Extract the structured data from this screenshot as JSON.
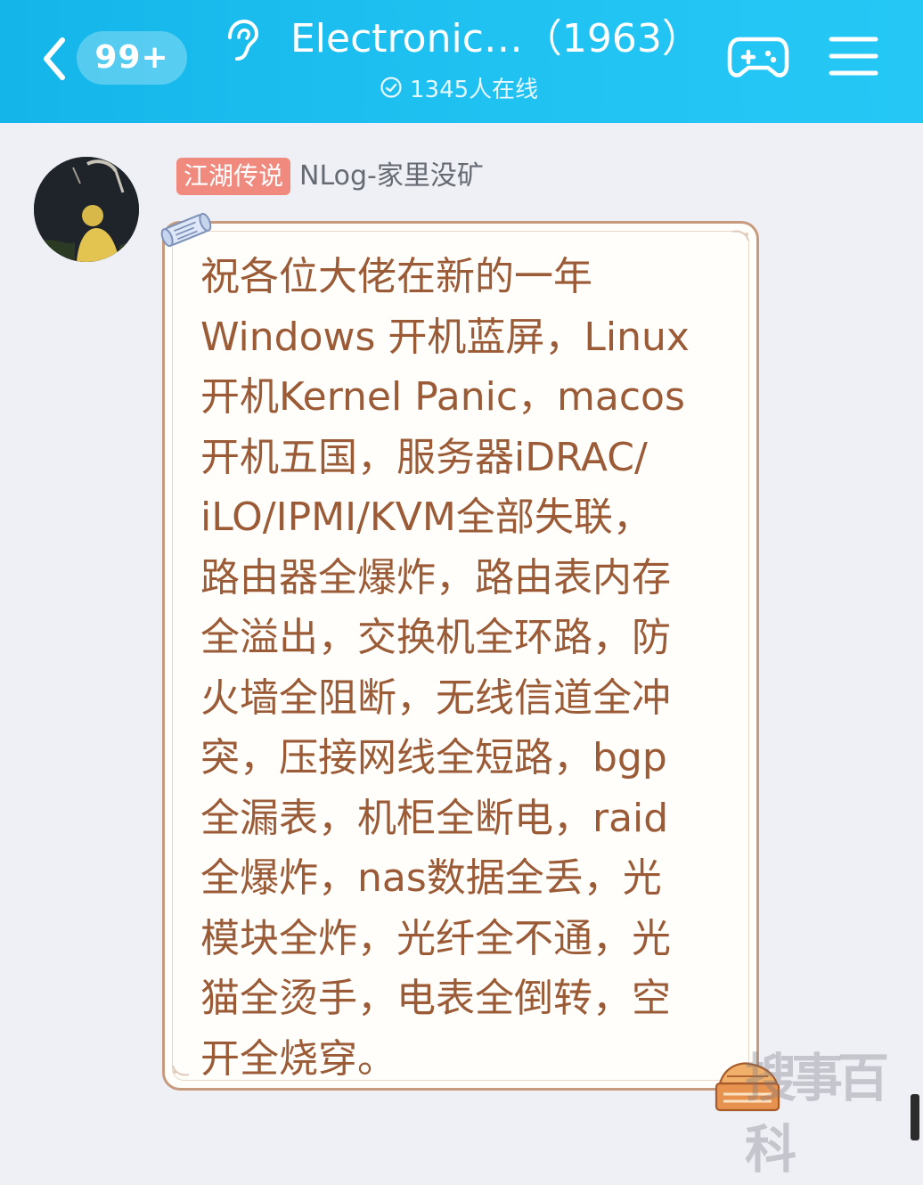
{
  "header": {
    "unread_badge": "99+",
    "title": "Electronic…（1963）",
    "online_count": "1345人在线"
  },
  "message": {
    "rank_tag": "江湖传说",
    "sender_name": "NLog-家里没矿",
    "text": "祝各位大佬在新的一年\nWindows 开机蓝屏，Linux\n开机Kernel Panic，macos\n开机五国，服务器iDRAC/\niLO/IPMI/KVM全部失联，\n路由器全爆炸，路由表内存\n全溢出，交换机全环路，防\n火墙全阻断，无线信道全冲\n突，压接网线全短路，bgp\n全漏表，机柜全断电，raid\n全爆炸，nas数据全丢，光\n模块全炸，光纤全不通，光\n猫全烫手，电表全倒转，空\n开全烧穿。"
  },
  "watermark": "搜事百科",
  "colors": {
    "header_start": "#14b6ea",
    "header_end": "#25c8f5",
    "page_background": "#eef0f6",
    "message_text": "#9a5b36",
    "bubble_border": "#c79a7e",
    "rank_tag": "#f08a7e"
  },
  "icons": {
    "back": "chevron-left-icon",
    "ear": "ear-icon",
    "online": "check-circle-icon",
    "game": "gamepad-icon",
    "menu": "hamburger-menu-icon"
  }
}
